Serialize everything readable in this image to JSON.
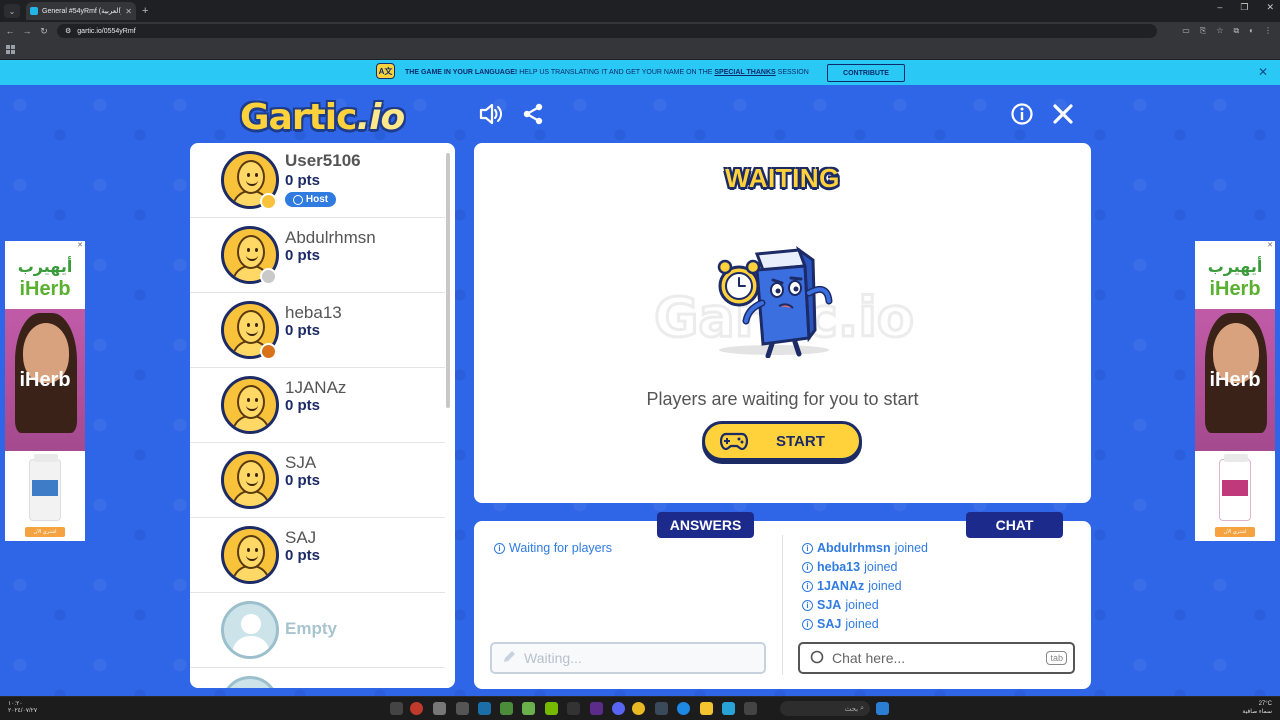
{
  "browser": {
    "tab_title": "General #54yRmf (العربية) - Gartic",
    "url": "gartic.io/0554yRmf"
  },
  "announcement": {
    "lead": "THE GAME IN YOUR LANGUAGE!",
    "body": "HELP US TRANSLATING IT AND GET YOUR NAME ON THE",
    "link": "SPECIAL THANKS",
    "tail": "SESSION",
    "button": "CONTRIBUTE",
    "icon": "language-icon"
  },
  "logo": {
    "part1": "Gartic",
    "part2": ".io"
  },
  "toolbar": {
    "sound_icon": "sound-icon",
    "share_icon": "share-icon",
    "info_icon": "info-icon",
    "close_icon": "close-icon"
  },
  "players": [
    {
      "name": "User5106",
      "points": "0 pts",
      "status_color": "#f8c33a",
      "host": true
    },
    {
      "name": "Abdulrhmsn",
      "points": "0 pts",
      "status_color": "#c9c9c9",
      "host": false
    },
    {
      "name": "heba13",
      "points": "0 pts",
      "status_color": "#d8731c",
      "host": false
    },
    {
      "name": "1JANAz",
      "points": "0 pts",
      "status_color": "",
      "host": false
    },
    {
      "name": "SJA",
      "points": "0 pts",
      "status_color": "",
      "host": false
    },
    {
      "name": "SAJ",
      "points": "0 pts",
      "status_color": "",
      "host": false
    }
  ],
  "host_badge": "Host",
  "empty_slot": "Empty",
  "waiting": {
    "title": "WAITING",
    "message": "Players are waiting for you to start",
    "start_button": "START"
  },
  "answers": {
    "tab": "ANSWERS",
    "status": "Waiting for players",
    "placeholder": "Waiting..."
  },
  "chat": {
    "tab": "CHAT",
    "joined_word": "joined",
    "messages": [
      "Abdulrhmsn",
      "heba13",
      "1JANAz",
      "SJA",
      "SAJ"
    ],
    "placeholder": "Chat here...",
    "key_hint": "tab"
  },
  "ads": {
    "brand_ar": "أيهيرب",
    "brand": "iHerb",
    "photo_text": "iHerb",
    "cta": "اشتري الآن"
  },
  "taskbar": {
    "weather": "27°C",
    "weather_sub": "سماء صافية",
    "search": "بحث"
  }
}
